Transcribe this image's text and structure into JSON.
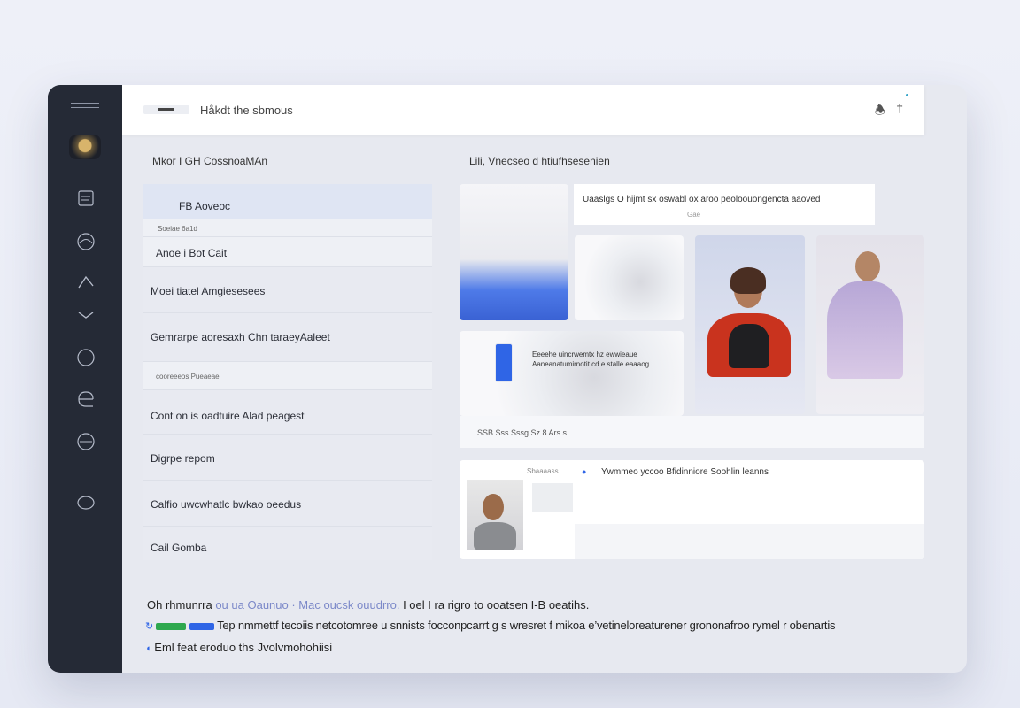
{
  "window": {
    "topbar": {
      "title": "Håkdt the sbmous",
      "icons": [
        "bell-icon",
        "pin-icon"
      ]
    },
    "sidebar": {
      "icons": [
        "document-icon",
        "globe-icon",
        "arrow-icon",
        "chevron-down-icon",
        "circle-icon",
        "e-icon",
        "e-circle-icon",
        "ring-icon"
      ]
    }
  },
  "left_panel": {
    "title": "Mkor I GH CossnoaMAn",
    "rows": [
      {
        "label": "FB Aoveoc",
        "state": "selected"
      },
      {
        "label": "Soeiae 6a1d",
        "state": "meta"
      },
      {
        "label": "Anoe i Bot Cait",
        "state": "sub"
      },
      {
        "label": "Moei tiatel Amgiesesees"
      },
      {
        "label": "Gemrarpe aoresaxh Chn taraeyAaleet"
      },
      {
        "label": "cooreeeos Pueaeae",
        "state": "meta"
      },
      {
        "label": "Cont on is oadtuire Alad peagest"
      },
      {
        "label": "Digrpe repom"
      },
      {
        "label": "Calfio uwcwhatlc bwkao oeedus"
      },
      {
        "label": "Cail Gomba"
      }
    ]
  },
  "right_panel": {
    "title": "Lili, Vnecseo d htiufhsesenien",
    "caption": {
      "line1": "Uaaslgs  O hijmt sx oswabl ox aroo peoloouongencta aaoved",
      "line2": "Gae"
    },
    "middle_card": {
      "text1": "Eeeehe uincrwemtx hz ewwieaue",
      "text2": "Aaneanatumirnotit cd e stalle eaaaog",
      "footer": "SSB  Sss Sssg  Sz 8 Ars s"
    },
    "bottom_card": {
      "label": "Sbaaaass",
      "text": "Ywmmeo yccoo Bfidinniore Soohlin leanns"
    }
  },
  "footer": {
    "line1_pre": "Oh rhmunrra",
    "line1_link": "ou ua Oaunuo  ·  Mac oucsk ouudrro.",
    "line1_post": " I oel I ra rigro to ooatsen I-B oeatihs.",
    "line2": "Tep nmmettf tecoiis netcotomree u snnists focconpcarrt g s wresret f mikoa e’vetineloreaturener grononafroo rymel r obenartis",
    "line3": "Eml feat eroduo ths Jvolvmohohiisi"
  }
}
